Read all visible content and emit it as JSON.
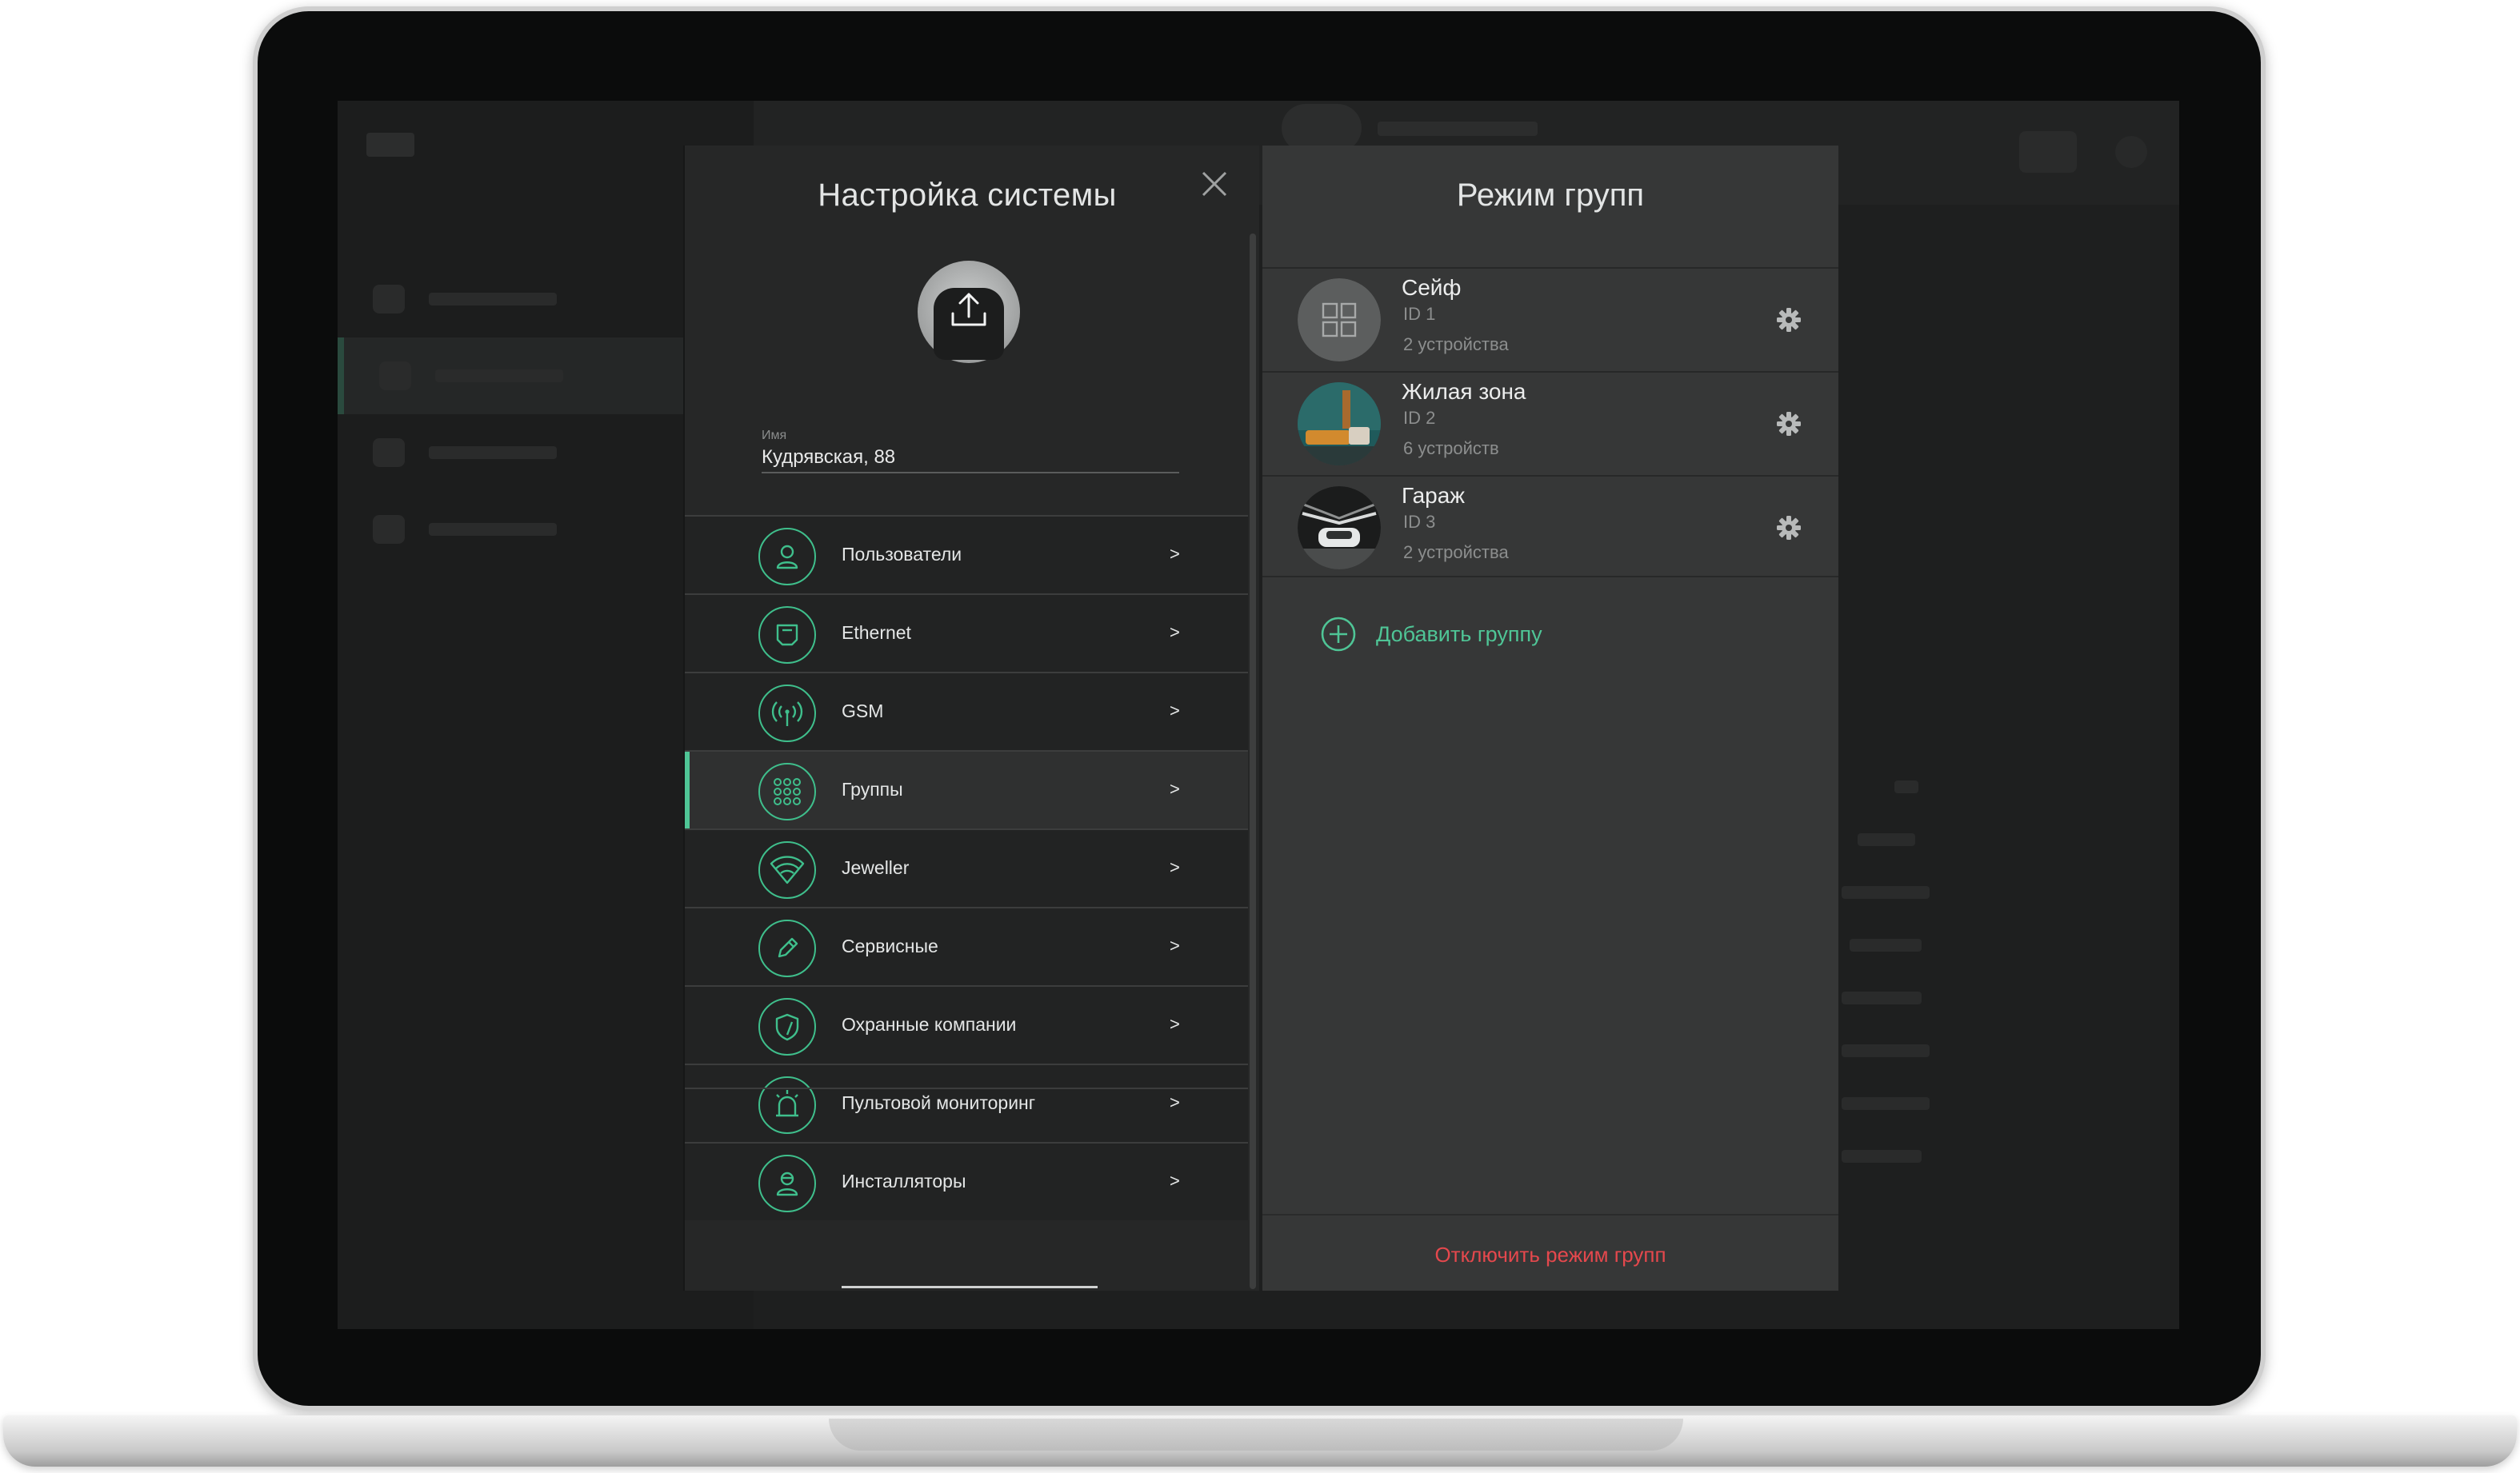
{
  "settings": {
    "title": "Настройка системы",
    "name_field": {
      "label": "Имя",
      "value": "Кудрявская, 88"
    },
    "menu": [
      {
        "label": "Пользователи",
        "icon": "user-icon",
        "arrow": ">"
      },
      {
        "label": "Ethernet",
        "icon": "ethernet-icon",
        "arrow": ">"
      },
      {
        "label": "GSM",
        "icon": "gsm-antenna-icon",
        "arrow": ">"
      },
      {
        "label": "Группы",
        "icon": "groups-grid-icon",
        "arrow": ">",
        "active": true
      },
      {
        "label": "Jeweller",
        "icon": "wifi-icon",
        "arrow": ">"
      },
      {
        "label": "Сервисные",
        "icon": "pencil-icon",
        "arrow": ">"
      },
      {
        "label": "Охранные компании",
        "icon": "shield-icon",
        "arrow": ">"
      },
      {
        "label": "Пультовой мониторинг",
        "icon": "alarm-siren-icon",
        "arrow": ">"
      },
      {
        "label": "Инсталляторы",
        "icon": "installer-icon",
        "arrow": ">"
      }
    ]
  },
  "groups_panel": {
    "title": "Режим групп",
    "groups": [
      {
        "name": "Сейф",
        "id": "ID 1",
        "count": "2 устройства",
        "avatar": "grid-placeholder"
      },
      {
        "name": "Жилая зона",
        "id": "ID 2",
        "count": "6 устройств",
        "avatar": "living-room-photo"
      },
      {
        "name": "Гараж",
        "id": "ID 3",
        "count": "2 устройства",
        "avatar": "garage-photo"
      }
    ],
    "add_label": "Добавить группу",
    "disable_label": "Отключить режим групп"
  },
  "colors": {
    "accent": "#4fc596",
    "danger": "#e5484d",
    "panel_dark": "#262727",
    "panel_mid": "#363737"
  }
}
